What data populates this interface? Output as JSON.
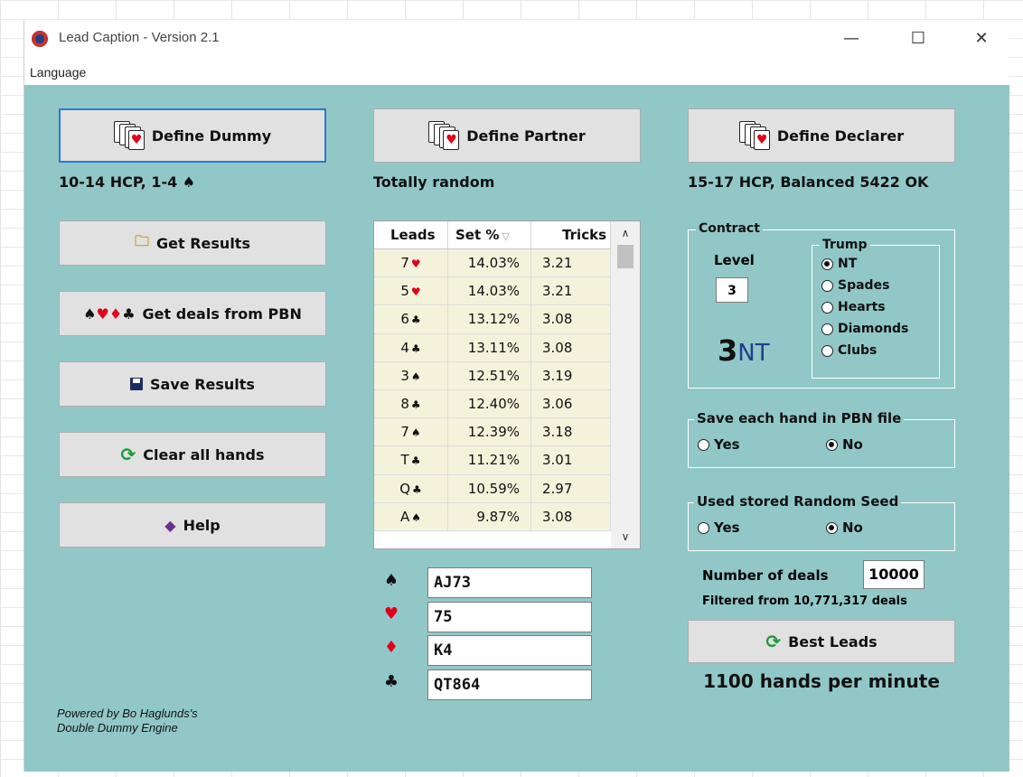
{
  "window": {
    "title": "Lead Caption - Version 2.1",
    "controls": {
      "minimize": "—",
      "maximize": "☐",
      "close": "✕"
    }
  },
  "menu": {
    "items": [
      "Language"
    ]
  },
  "buttons": {
    "define_dummy": "Define Dummy",
    "define_partner": "Define Partner",
    "define_declarer": "Define Declarer",
    "get_results": "Get Results",
    "get_deals_pbn": "Get deals from PBN",
    "save_results": "Save Results",
    "clear_all_hands": "Clear all hands",
    "help": "Help",
    "best_leads": "Best Leads"
  },
  "descriptions": {
    "dummy": "10-14 HCP, 1-4 ♠",
    "partner": "Totally random",
    "declarer": "15-17 HCP, Balanced 5422 OK"
  },
  "results_grid": {
    "columns": [
      "Leads",
      "Set %",
      "Tricks"
    ],
    "sort_indicator": "▽",
    "rows": [
      {
        "lead_rank": "7",
        "lead_suit": "♥",
        "suit_color": "#e0001b",
        "set_pct": "14.03%",
        "tricks": "3.21"
      },
      {
        "lead_rank": "5",
        "lead_suit": "♥",
        "suit_color": "#e0001b",
        "set_pct": "14.03%",
        "tricks": "3.21"
      },
      {
        "lead_rank": "6",
        "lead_suit": "♣",
        "suit_color": "#111111",
        "set_pct": "13.12%",
        "tricks": "3.08"
      },
      {
        "lead_rank": "4",
        "lead_suit": "♣",
        "suit_color": "#111111",
        "set_pct": "13.11%",
        "tricks": "3.08"
      },
      {
        "lead_rank": "3",
        "lead_suit": "♠",
        "suit_color": "#111111",
        "set_pct": "12.51%",
        "tricks": "3.19"
      },
      {
        "lead_rank": "8",
        "lead_suit": "♣",
        "suit_color": "#111111",
        "set_pct": "12.40%",
        "tricks": "3.06"
      },
      {
        "lead_rank": "7",
        "lead_suit": "♠",
        "suit_color": "#111111",
        "set_pct": "12.39%",
        "tricks": "3.18"
      },
      {
        "lead_rank": "T",
        "lead_suit": "♣",
        "suit_color": "#111111",
        "set_pct": "11.21%",
        "tricks": "3.01"
      },
      {
        "lead_rank": "Q",
        "lead_suit": "♣",
        "suit_color": "#111111",
        "set_pct": "10.59%",
        "tricks": "2.97"
      },
      {
        "lead_rank": "A",
        "lead_suit": "♠",
        "suit_color": "#111111",
        "set_pct": "9.87%",
        "tricks": "3.08"
      }
    ]
  },
  "hand": {
    "spades": {
      "symbol": "♠",
      "color": "#111111",
      "value": "AJ73"
    },
    "hearts": {
      "symbol": "♥",
      "color": "#e0001b",
      "value": "75"
    },
    "diamonds": {
      "symbol": "♦",
      "color": "#e0001b",
      "value": "K4"
    },
    "clubs": {
      "symbol": "♣",
      "color": "#111111",
      "value": "QT864"
    }
  },
  "contract": {
    "label": "Contract",
    "level_label": "Level",
    "level_value": "3",
    "display_level": "3",
    "display_strain": "NT",
    "trump_label": "Trump",
    "trump_options": [
      {
        "label": "NT",
        "selected": true
      },
      {
        "label": "Spades",
        "selected": false
      },
      {
        "label": "Hearts",
        "selected": false
      },
      {
        "label": "Diamonds",
        "selected": false
      },
      {
        "label": "Clubs",
        "selected": false
      }
    ]
  },
  "save_pbn": {
    "label": "Save each hand in PBN file",
    "options": [
      {
        "label": "Yes",
        "selected": false
      },
      {
        "label": "No",
        "selected": true
      }
    ]
  },
  "random_seed": {
    "label": "Used stored Random Seed",
    "options": [
      {
        "label": "Yes",
        "selected": false
      },
      {
        "label": "No",
        "selected": true
      }
    ]
  },
  "deals": {
    "label": "Number of deals",
    "value": "10000",
    "filtered_text": "Filtered from 10,771,317 deals"
  },
  "speed_text": "1100 hands per minute",
  "footer": {
    "line1": "Powered by Bo Haglunds's",
    "line2": "Double Dummy Engine"
  },
  "colors": {
    "client_bg": "#91c8c7",
    "grid_cell_bg": "#f5f2dc",
    "focus_border": "#2f77d1",
    "nt_text": "#213d8f",
    "red_suit": "#e0001b"
  }
}
